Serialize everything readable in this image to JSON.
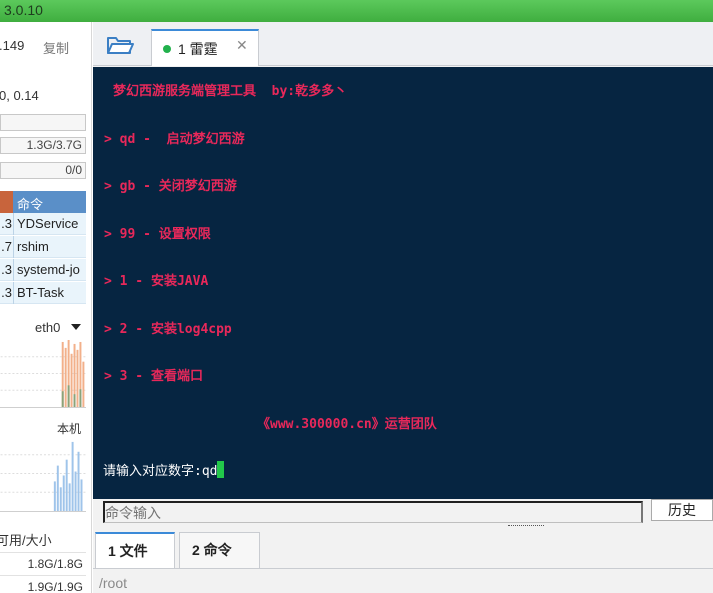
{
  "title_bar": {
    "version": "3.0.10"
  },
  "sidebar": {
    "ip_fragment": ".149",
    "copy_label": "复制",
    "load_fragment": "0, 0.14",
    "memory": "1.3G/3.7G",
    "swap": "0/0",
    "process_header": "命令",
    "processes": [
      {
        "value": ".3",
        "name": "YDService"
      },
      {
        "value": ".7",
        "name": "rshim"
      },
      {
        "value": ".3",
        "name": "systemd-jo"
      },
      {
        "value": ".3",
        "name": "BT-Task"
      }
    ],
    "net_interface": "eth0",
    "local_label": "本机",
    "disk_header": "可用/大小",
    "disks": [
      "1.8G/1.8G",
      "1.9G/1.9G"
    ]
  },
  "tabs": {
    "session_tab": "1 雷霆"
  },
  "terminal": {
    "lines": [
      "梦幻西游服务端管理工具  by:乾多多丶",
      "> qd -  启动梦幻西游",
      "> gb - 关闭梦幻西游",
      "> 99 - 设置权限",
      "> 1 - 安装JAVA",
      "> 2 - 安装log4cpp",
      "> 3 - 查看端口",
      "《www.300000.cn》运营团队"
    ],
    "prompt": "请输入对应数字:qd"
  },
  "command_input": {
    "placeholder": "命令输入"
  },
  "history_button": "历史",
  "bottom_tabs": [
    "1 文件",
    "2 命令"
  ],
  "path": "/root",
  "colors": {
    "terminal_bg": "#062541",
    "terminal_text": "#e8285a",
    "cursor": "#22c84a",
    "title_bar": "#4cbb4c",
    "tab_accent": "#3b8ad8"
  }
}
